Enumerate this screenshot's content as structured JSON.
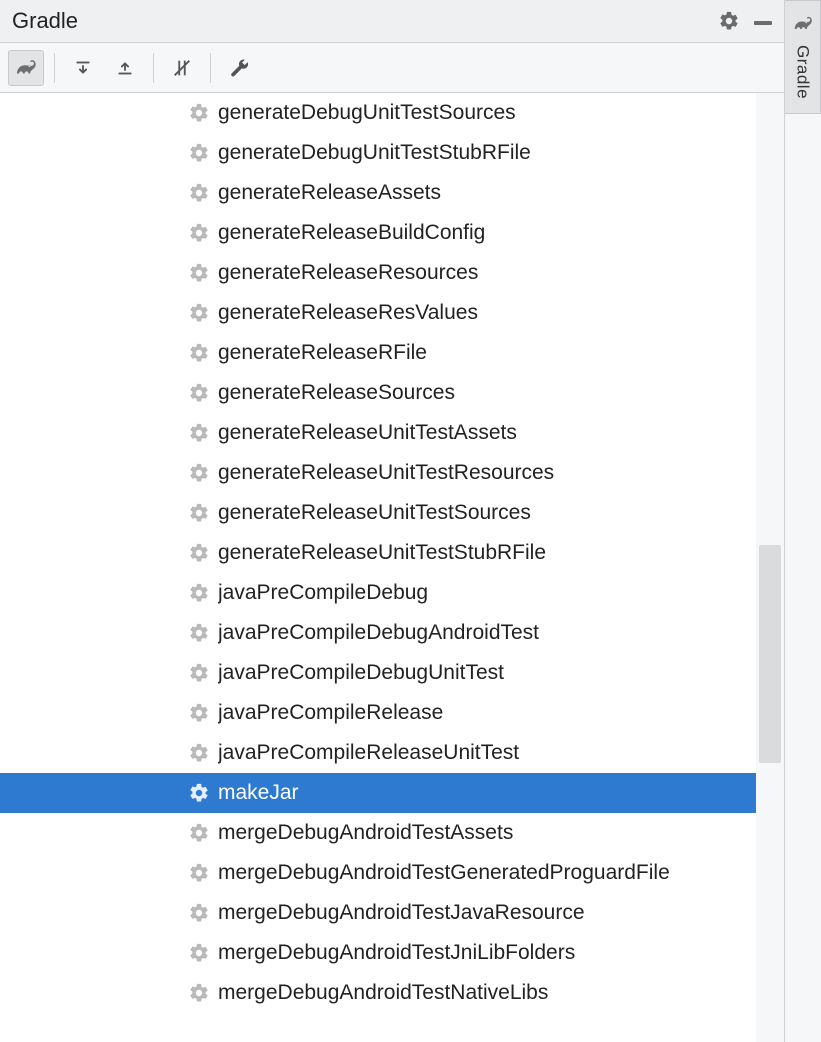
{
  "header": {
    "title": "Gradle"
  },
  "sideTab": {
    "label": "Gradle"
  },
  "tasks": [
    {
      "label": "generateDebugUnitTestSources",
      "selected": false
    },
    {
      "label": "generateDebugUnitTestStubRFile",
      "selected": false
    },
    {
      "label": "generateReleaseAssets",
      "selected": false
    },
    {
      "label": "generateReleaseBuildConfig",
      "selected": false
    },
    {
      "label": "generateReleaseResources",
      "selected": false
    },
    {
      "label": "generateReleaseResValues",
      "selected": false
    },
    {
      "label": "generateReleaseRFile",
      "selected": false
    },
    {
      "label": "generateReleaseSources",
      "selected": false
    },
    {
      "label": "generateReleaseUnitTestAssets",
      "selected": false
    },
    {
      "label": "generateReleaseUnitTestResources",
      "selected": false
    },
    {
      "label": "generateReleaseUnitTestSources",
      "selected": false
    },
    {
      "label": "generateReleaseUnitTestStubRFile",
      "selected": false
    },
    {
      "label": "javaPreCompileDebug",
      "selected": false
    },
    {
      "label": "javaPreCompileDebugAndroidTest",
      "selected": false
    },
    {
      "label": "javaPreCompileDebugUnitTest",
      "selected": false
    },
    {
      "label": "javaPreCompileRelease",
      "selected": false
    },
    {
      "label": "javaPreCompileReleaseUnitTest",
      "selected": false
    },
    {
      "label": "makeJar",
      "selected": true
    },
    {
      "label": "mergeDebugAndroidTestAssets",
      "selected": false
    },
    {
      "label": "mergeDebugAndroidTestGeneratedProguardFile",
      "selected": false
    },
    {
      "label": "mergeDebugAndroidTestJavaResource",
      "selected": false
    },
    {
      "label": "mergeDebugAndroidTestJniLibFolders",
      "selected": false
    },
    {
      "label": "mergeDebugAndroidTestNativeLibs",
      "selected": false
    }
  ]
}
